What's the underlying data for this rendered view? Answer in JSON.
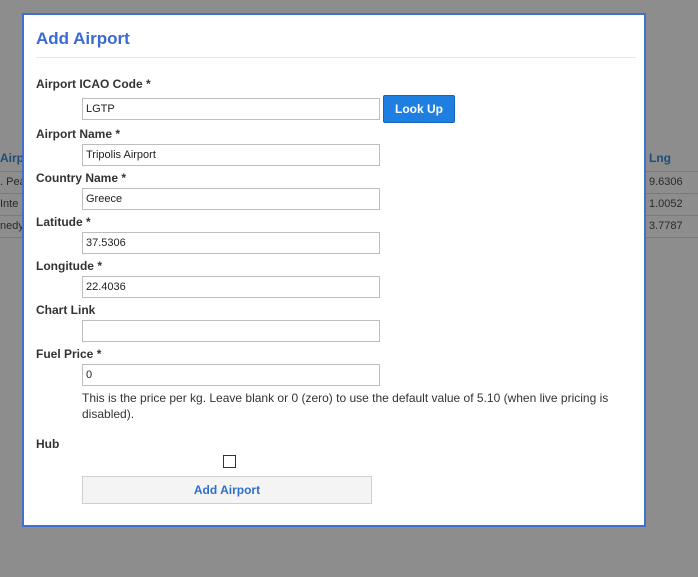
{
  "background": {
    "left_header": "Airp",
    "right_header": "Lng",
    "rows": [
      {
        "left": ". Pea",
        "right": "9.6306"
      },
      {
        "left": "Inte",
        "right": "1.0052"
      },
      {
        "left": "nedy",
        "right": "3.7787"
      }
    ]
  },
  "modal": {
    "title": "Add Airport",
    "fields": {
      "icao": {
        "label": "Airport ICAO Code *",
        "value": "LGTP"
      },
      "name": {
        "label": "Airport Name *",
        "value": "Tripolis Airport"
      },
      "country": {
        "label": "Country Name *",
        "value": "Greece"
      },
      "latitude": {
        "label": "Latitude *",
        "value": "37.5306"
      },
      "longitude": {
        "label": "Longitude *",
        "value": "22.4036"
      },
      "chart_link": {
        "label": "Chart Link",
        "value": ""
      },
      "fuel_price": {
        "label": "Fuel Price *",
        "value": "0"
      }
    },
    "fuel_help": "This is the price per kg. Leave blank or 0 (zero) to use the default value of 5.10 (when live pricing is disabled).",
    "hub": {
      "label": "Hub",
      "checked": false
    },
    "lookup_label": "Look Up",
    "submit_label": "Add Airport"
  },
  "colors": {
    "accent": "#3a6bd4",
    "button_primary": "#1e7fe0",
    "overlay": "#8d8d8d"
  }
}
